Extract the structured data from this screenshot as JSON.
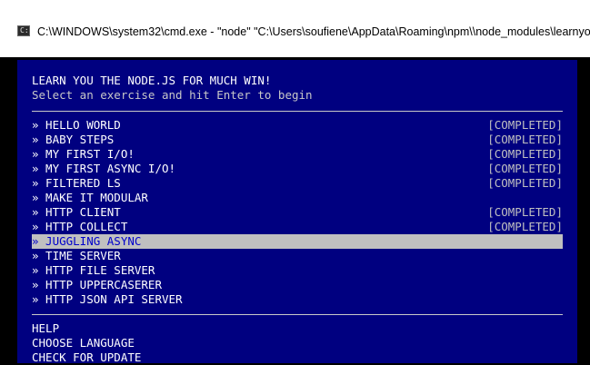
{
  "window": {
    "title": "C:\\WINDOWS\\system32\\cmd.exe  - \"node\"  \"C:\\Users\\soufiene\\AppData\\Roaming\\npm\\\\node_modules\\learnyou"
  },
  "header": {
    "title": "LEARN YOU THE NODE.JS FOR MUCH WIN!",
    "subtitle": "Select an exercise and hit Enter to begin"
  },
  "menu": {
    "arrow": "»",
    "items": [
      {
        "label": "HELLO WORLD",
        "status": "[COMPLETED]"
      },
      {
        "label": "BABY STEPS",
        "status": "[COMPLETED]"
      },
      {
        "label": "MY FIRST I/O!",
        "status": "[COMPLETED]"
      },
      {
        "label": "MY FIRST ASYNC I/O!",
        "status": "[COMPLETED]"
      },
      {
        "label": "FILTERED LS",
        "status": "[COMPLETED]"
      },
      {
        "label": "MAKE IT MODULAR",
        "status": ""
      },
      {
        "label": "HTTP CLIENT",
        "status": "[COMPLETED]"
      },
      {
        "label": "HTTP COLLECT",
        "status": "[COMPLETED]"
      },
      {
        "label": "JUGGLING ASYNC",
        "status": ""
      },
      {
        "label": "TIME SERVER",
        "status": ""
      },
      {
        "label": "HTTP FILE SERVER",
        "status": ""
      },
      {
        "label": "HTTP UPPERCASERER",
        "status": ""
      },
      {
        "label": "HTTP JSON API SERVER",
        "status": ""
      }
    ],
    "selected_index": 8
  },
  "footer": {
    "items": [
      "HELP",
      "CHOOSE LANGUAGE",
      "CHECK FOR UPDATE"
    ]
  },
  "colors": {
    "terminal_bg": "#000080",
    "selection_bg": "#c0c0c0",
    "selection_text": "#0000cc",
    "text": "#ffffff"
  }
}
